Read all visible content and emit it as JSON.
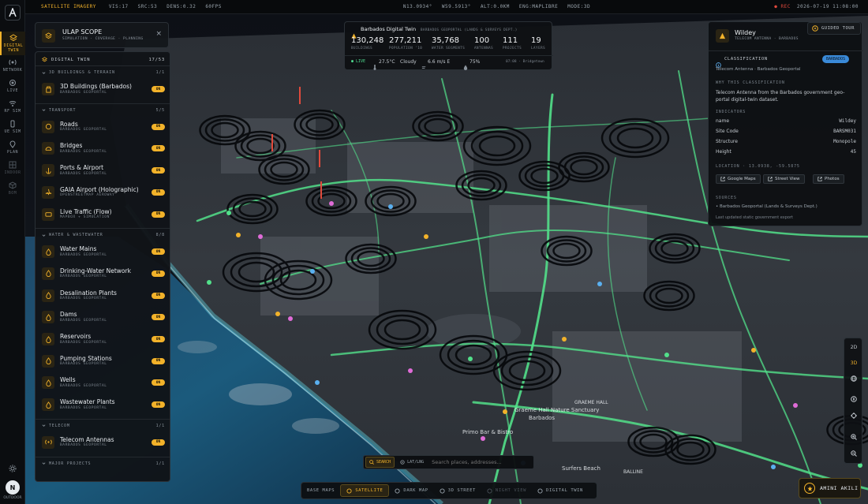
{
  "topbar": {
    "mode_label": "SATELLITE IMAGERY",
    "vis": "VIS:17",
    "src": "SRC:53",
    "dens": "DENS:0.32",
    "fps": "60FPS",
    "lat": "N13.0934°",
    "lon": "W59.5913°",
    "alt": "ALT:0.0KM",
    "eng": "ENG:MAPLIBRE",
    "view_mode": "MODE:3D",
    "rec": "● REC",
    "datetime": "2026-07-19 11:08:00"
  },
  "rail": {
    "items": [
      {
        "label": "DIGITAL TWIN",
        "icon": "layers-icon",
        "active": true
      },
      {
        "label": "NETWORK",
        "icon": "network-icon"
      },
      {
        "label": "LIVE",
        "icon": "broadcast-icon"
      },
      {
        "label": "RF SIM",
        "icon": "wifi-icon"
      },
      {
        "label": "UE SIM",
        "icon": "phone-icon"
      },
      {
        "label": "PLAN",
        "icon": "pin-icon"
      },
      {
        "label": "INDOOR",
        "icon": "grid-icon"
      },
      {
        "label": "BOM",
        "icon": "box-icon"
      }
    ],
    "bottom_label": "OUTDOOR",
    "avatar_letter": "N"
  },
  "scope": {
    "title": "ULAP SCOPE",
    "subtitle": "SIMULATION · COVERAGE · PLANNING",
    "close": "×"
  },
  "layers": {
    "header": "DIGITAL TWIN",
    "header_count": "17/53",
    "sections": [
      {
        "title": "3D BUILDINGS & TERRAIN",
        "count": "1/1",
        "items": [
          {
            "name": "3D Buildings (Barbados)",
            "source": "BARBADOS GEOPORTAL",
            "state": "ON"
          }
        ]
      },
      {
        "title": "TRANSPORT",
        "count": "5/5",
        "items": [
          {
            "name": "Roads",
            "source": "BARBADOS GEOPORTAL",
            "state": "ON"
          },
          {
            "name": "Bridges",
            "source": "BARBADOS GEOPORTAL",
            "state": "ON"
          },
          {
            "name": "Ports & Airport",
            "source": "BARBADOS GEOPORTAL",
            "state": "ON"
          },
          {
            "name": "GAIA Airport (Holographic)",
            "source": "OPENSTREETMAP AEROWAY",
            "state": "ON"
          },
          {
            "name": "Live Traffic (Flow)",
            "source": "MAPBOX + SIMULATION",
            "state": "ON"
          }
        ]
      },
      {
        "title": "WATER & WASTEWATER",
        "count": "8/8",
        "items": [
          {
            "name": "Water Mains",
            "source": "BARBADOS GEOPORTAL",
            "state": "ON"
          },
          {
            "name": "Drinking-Water Network",
            "source": "BARBADOS GEOPORTAL",
            "state": "ON"
          },
          {
            "name": "Desalination Plants",
            "source": "BARBADOS GEOPORTAL",
            "state": "ON"
          },
          {
            "name": "Dams",
            "source": "BARBADOS GEOPORTAL",
            "state": "ON"
          },
          {
            "name": "Reservoirs",
            "source": "BARBADOS GEOPORTAL",
            "state": "ON"
          },
          {
            "name": "Pumping Stations",
            "source": "BARBADOS GEOPORTAL",
            "state": "ON"
          },
          {
            "name": "Wells",
            "source": "BARBADOS GEOPORTAL",
            "state": "ON"
          },
          {
            "name": "Wastewater Plants",
            "source": "BARBADOS GEOPORTAL",
            "state": "ON"
          }
        ]
      },
      {
        "title": "TELECOM",
        "count": "1/1",
        "items": [
          {
            "name": "Telecom Antennas",
            "source": "BARBADOS GEOPORTAL",
            "state": "ON"
          }
        ]
      },
      {
        "title": "MAJOR PROJECTS",
        "count": "1/1",
        "items": []
      }
    ]
  },
  "twin": {
    "title": "Barbados Digital Twin",
    "source": "BARBADOS GEOPORTAL (LANDS & SURVEYS DEPT.)",
    "stats": [
      {
        "value": "130,248",
        "label": "BUILDINGS"
      },
      {
        "value": "277,211",
        "label": "POPULATION '10"
      },
      {
        "value": "35,768",
        "label": "WATER SEGMENTS"
      },
      {
        "value": "100",
        "label": "ANTENNAS"
      },
      {
        "value": "111",
        "label": "PROJECTS"
      },
      {
        "value": "19",
        "label": "LAYERS"
      }
    ],
    "live": "● LIVE",
    "temp": "27.5°C",
    "weather": "Cloudy",
    "wind": "6.6 m/s E",
    "humidity": "75%",
    "time": "07:08 · Bridgetown"
  },
  "detail": {
    "title": "Wildey",
    "subtitle": "TELECOM ANTENNA · BARBADOS",
    "classification_label": "CLASSIFICATION",
    "classification_badge": "BARBADOS",
    "classification_value": "Telecom Antenna · Barbados Geoportal",
    "why_label": "WHY THIS CLASSIFICATION",
    "why_text": "Telecom Antenna from the Barbados government geo-portal digital-twin dataset.",
    "indicators_label": "INDICATORS",
    "indicators": [
      {
        "k": "name",
        "v": "Wildey"
      },
      {
        "k": "Site Code",
        "v": "BARSM031"
      },
      {
        "k": "Structure",
        "v": "Monopole"
      },
      {
        "k": "Height",
        "v": "45"
      }
    ],
    "location": "LOCATION · 13.0938, -59.5875",
    "buttons": [
      "Google Maps",
      "Street View",
      "Photos"
    ],
    "sources_label": "SOURCES",
    "source_text": "• Barbados Geoportal (Lands & Surveys Dept.)",
    "updated": "Last updated static government export"
  },
  "tour": "GUIDED TOUR",
  "map_controls": [
    "2D",
    "3D"
  ],
  "search": {
    "tab_search": "SEARCH",
    "tab_latlng": "LAT/LNG",
    "placeholder": "Search places, addresses..."
  },
  "basemaps": {
    "label": "BASE MAPS",
    "options": [
      {
        "label": "SATELLITE",
        "state": "active"
      },
      {
        "label": "DARK MAP",
        "state": "normal"
      },
      {
        "label": "3D STREET",
        "state": "normal"
      },
      {
        "label": "NIGHT VIEW",
        "state": "disabled"
      },
      {
        "label": "DIGITAL TWIN",
        "state": "normal"
      }
    ]
  },
  "user": {
    "name": "AMINI AKILI"
  },
  "map_labels": [
    "Graeme Hall Nature Sanctuary",
    "Barbados",
    "Primo Bar & Bistro",
    "Surfers Beach",
    "GRAEME HALL",
    "BALLINE"
  ],
  "colors": {
    "accent": "#f2b22a",
    "road": "#52e08a",
    "badge": "#3a8ad8"
  }
}
